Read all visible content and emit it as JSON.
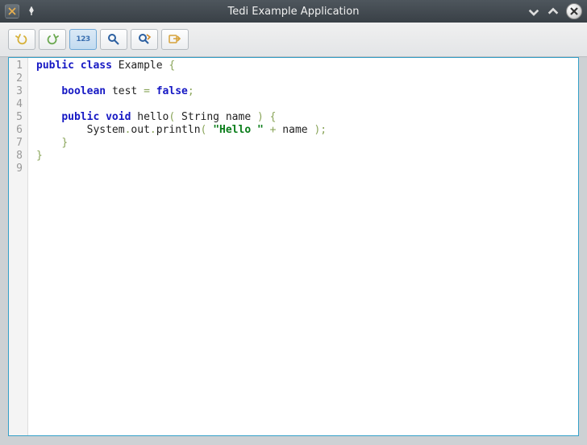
{
  "window": {
    "title": "Tedi Example Application"
  },
  "toolbar": {
    "buttons": {
      "undo": "undo-icon",
      "redo": "redo-icon",
      "line_numbers_label": "123",
      "find": "find-icon",
      "find_replace": "find-replace-icon",
      "goto": "goto-icon"
    }
  },
  "editor": {
    "line_count": 9,
    "code": {
      "language": "java",
      "lines": [
        [
          {
            "t": "public",
            "c": "kw"
          },
          {
            "t": " ",
            "c": "plain"
          },
          {
            "t": "class",
            "c": "kw"
          },
          {
            "t": " ",
            "c": "plain"
          },
          {
            "t": "Example",
            "c": "ident"
          },
          {
            "t": " ",
            "c": "plain"
          },
          {
            "t": "{",
            "c": "punct"
          }
        ],
        [],
        [
          {
            "t": "    ",
            "c": "plain"
          },
          {
            "t": "boolean",
            "c": "type"
          },
          {
            "t": " ",
            "c": "plain"
          },
          {
            "t": "test",
            "c": "ident"
          },
          {
            "t": " ",
            "c": "plain"
          },
          {
            "t": "=",
            "c": "punct"
          },
          {
            "t": " ",
            "c": "plain"
          },
          {
            "t": "false",
            "c": "kw"
          },
          {
            "t": ";",
            "c": "punct"
          }
        ],
        [],
        [
          {
            "t": "    ",
            "c": "plain"
          },
          {
            "t": "public",
            "c": "kw"
          },
          {
            "t": " ",
            "c": "plain"
          },
          {
            "t": "void",
            "c": "type"
          },
          {
            "t": " ",
            "c": "plain"
          },
          {
            "t": "hello",
            "c": "ident"
          },
          {
            "t": "(",
            "c": "punct"
          },
          {
            "t": " ",
            "c": "plain"
          },
          {
            "t": "String",
            "c": "ident"
          },
          {
            "t": " ",
            "c": "plain"
          },
          {
            "t": "name",
            "c": "ident"
          },
          {
            "t": " ",
            "c": "plain"
          },
          {
            "t": ")",
            "c": "punct"
          },
          {
            "t": " ",
            "c": "plain"
          },
          {
            "t": "{",
            "c": "punct"
          }
        ],
        [
          {
            "t": "        ",
            "c": "plain"
          },
          {
            "t": "System",
            "c": "ident"
          },
          {
            "t": ".",
            "c": "punct"
          },
          {
            "t": "out",
            "c": "ident"
          },
          {
            "t": ".",
            "c": "punct"
          },
          {
            "t": "println",
            "c": "ident"
          },
          {
            "t": "(",
            "c": "punct"
          },
          {
            "t": " ",
            "c": "plain"
          },
          {
            "t": "\"Hello \"",
            "c": "str"
          },
          {
            "t": " ",
            "c": "plain"
          },
          {
            "t": "+",
            "c": "punct"
          },
          {
            "t": " ",
            "c": "plain"
          },
          {
            "t": "name",
            "c": "ident"
          },
          {
            "t": " ",
            "c": "plain"
          },
          {
            "t": ")",
            "c": "punct"
          },
          {
            "t": ";",
            "c": "punct"
          }
        ],
        [
          {
            "t": "    ",
            "c": "plain"
          },
          {
            "t": "}",
            "c": "punct"
          }
        ],
        [
          {
            "t": "}",
            "c": "punct"
          }
        ],
        []
      ]
    }
  }
}
